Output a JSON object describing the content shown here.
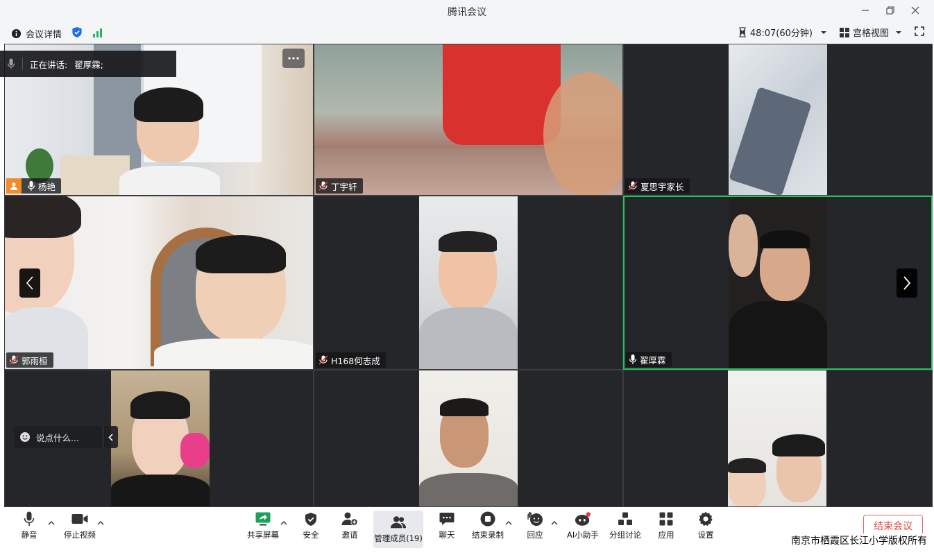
{
  "window": {
    "title": "腾讯会议"
  },
  "infobar": {
    "meeting_info": "会议详情",
    "timer": "48:07(60分钟)",
    "view_mode": "宫格视图"
  },
  "speaking": {
    "label": "正在讲话:",
    "name": "翟厚霖;"
  },
  "tiles": [
    {
      "name": "杨艳"
    },
    {
      "name": "丁宇轩"
    },
    {
      "name": "夏思宇家长"
    },
    {
      "name": "郭雨桓"
    },
    {
      "name": "H168何志成"
    },
    {
      "name": "翟厚霖"
    }
  ],
  "chat": {
    "placeholder": "说点什么..."
  },
  "toolbar": {
    "mute": "静音",
    "stop_video": "停止视频",
    "share_screen": "共享屏幕",
    "security": "安全",
    "invite": "邀请",
    "manage_members": "管理成员(19)",
    "chat": "聊天",
    "end_recording": "结束录制",
    "reaction": "回应",
    "ai_assistant": "AI小助手",
    "breakout": "分组讨论",
    "apps": "应用",
    "settings": "设置",
    "end_meeting": "结束会议"
  },
  "copyright": "南京市栖霞区长江小学版权所有",
  "colors": {
    "active_speaker_border": "#22c55e",
    "end_meeting": "#e04343",
    "accent_blue": "#1f6feb"
  }
}
